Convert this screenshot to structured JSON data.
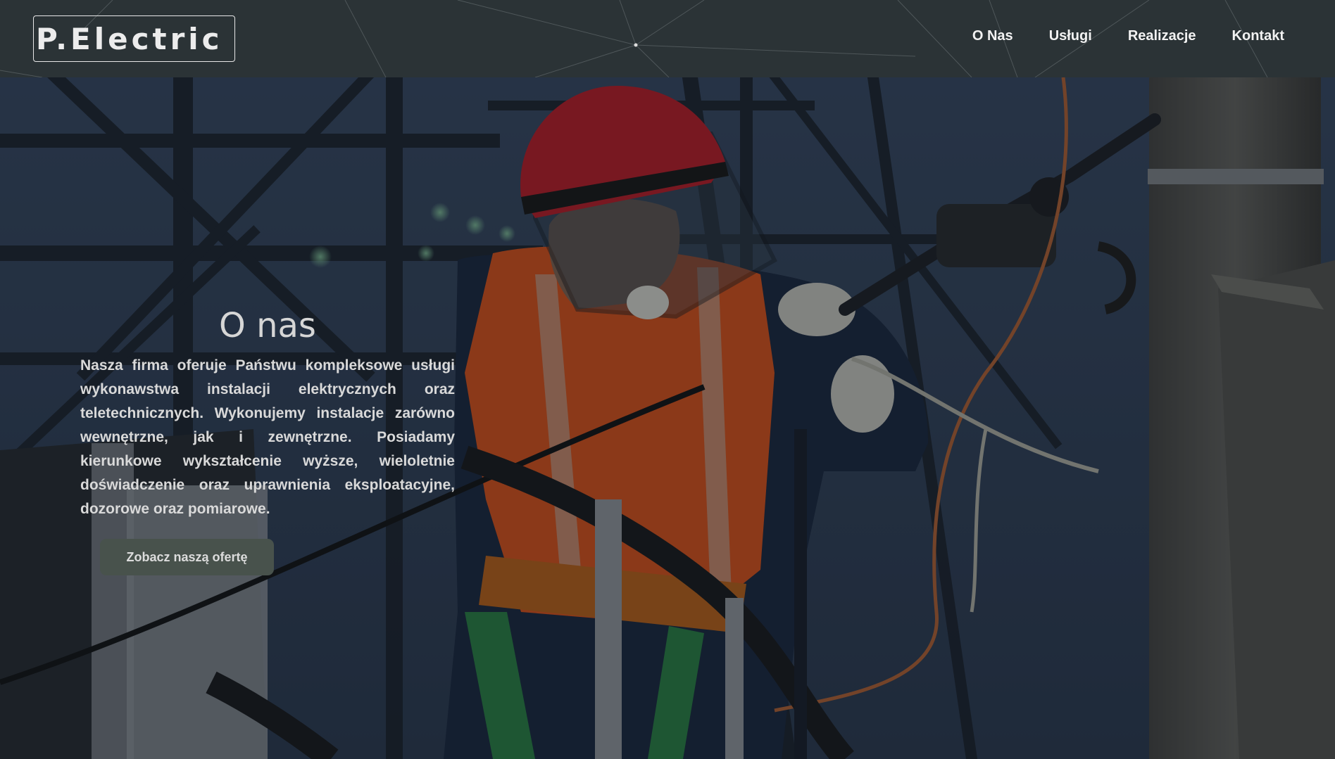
{
  "brand": {
    "logo_text": "P.Electric"
  },
  "nav": {
    "items": [
      {
        "label": "O Nas"
      },
      {
        "label": "Usługi"
      },
      {
        "label": "Realizacje"
      },
      {
        "label": "Kontakt"
      }
    ]
  },
  "about": {
    "title": "O nas",
    "body": "Nasza firma oferuje Państwu kompleksowe usługi wykonawstwa instalacji elektrycznych oraz teletechnicznych. Wykonujemy instalacje zarówno wewnętrzne, jak i zewnętrzne. Posiadamy kierunkowe wykształcenie wyższe, wieloletnie doświadczenie oraz uprawnienia eksploatacyjne, dozorowe oraz pomiarowe.",
    "cta_label": "Zobacz naszą ofertę"
  },
  "colors": {
    "header_bg": "#2b3336",
    "button_bg": "#48524c",
    "helmet": "#c8202b",
    "vest": "#e8581e"
  },
  "icons": {
    "hero_image": "electrician-on-power-pole-photo",
    "header_decoration": "network-lines-decoration"
  }
}
